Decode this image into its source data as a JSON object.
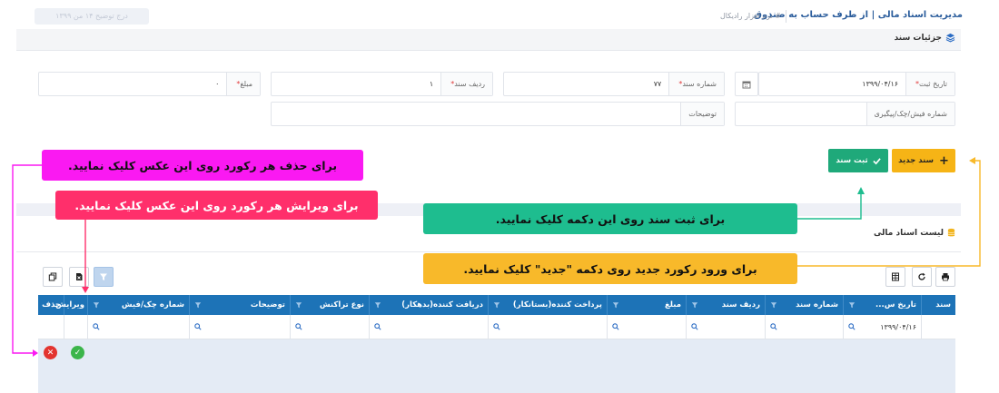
{
  "header": {
    "title": "مدیریت اسناد مالی | از طرف حساب به صندوق",
    "subtitle": "# نرم افزار رادیکال",
    "top_button": "درج توضیح ۱۴ من ۱۳۹۹"
  },
  "details_section": {
    "title": "جزئیات سند"
  },
  "form": {
    "date_label": "تاریخ ثبت",
    "date_value": "۱۳۹۹/۰۴/۱۶",
    "doc_no_label": "شماره سند",
    "doc_no_value": "۷۷",
    "row_label": "ردیف سند",
    "row_value": "۱",
    "amount_label": "مبلغ",
    "amount_value": "۰",
    "receipt_label": "شماره فیش/چک/پیگیری",
    "receipt_value": "",
    "desc_label": "توضیحات",
    "desc_value": ""
  },
  "buttons": {
    "new_doc": "سند جدید",
    "save_doc": "ثبت سند"
  },
  "callouts": {
    "delete": "برای حذف هر رکورد روی این عکس کلیک نمایید.",
    "edit": "برای ویرایش هر رکورد روی این عکس کلیک نمایید.",
    "save": "برای ثبت سند روی این دکمه کلیک نمایید.",
    "new": "برای ورود رکورد جدید روی دکمه \"جدید\" کلیک نمایید."
  },
  "list_section": {
    "title": "لیست اسناد مالی"
  },
  "grid": {
    "columns": [
      "سند",
      "تاریخ س...",
      "شماره سند",
      "ردیف سند",
      "مبلغ",
      "پرداخت کننده(بستانکار)",
      "دریافت کننده(بدهکار)",
      "نوع تراکنش",
      "توضیحات",
      "شماره چک/فیش",
      "ویرایش",
      "حذف"
    ],
    "filter_date_value": "۱۳۹۹/۰۴/۱۶"
  },
  "colors": {
    "accent_blue": "#1d73b7",
    "new_button": "#f6b416",
    "save_button": "#1fa97a",
    "callout_delete": "#fa19f2",
    "callout_edit": "#ff2f6b",
    "callout_save": "#1ebd8f",
    "callout_new": "#f8b92a"
  }
}
